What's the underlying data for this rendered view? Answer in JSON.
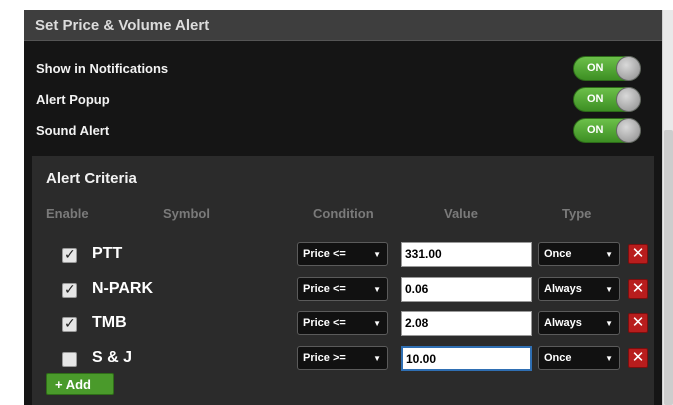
{
  "header": {
    "title": "Set Price & Volume Alert"
  },
  "settings": [
    {
      "label": "Show in Notifications",
      "toggle": "ON"
    },
    {
      "label": "Alert Popup",
      "toggle": "ON"
    },
    {
      "label": "Sound Alert",
      "toggle": "ON"
    }
  ],
  "criteria": {
    "title": "Alert Criteria",
    "columns": {
      "enable": "Enable",
      "symbol": "Symbol",
      "condition": "Condition",
      "value": "Value",
      "type": "Type"
    },
    "rows": [
      {
        "checked": true,
        "symbol": "PTT",
        "condition": "Price <=",
        "value": "331.00",
        "type": "Once"
      },
      {
        "checked": true,
        "symbol": "N-PARK",
        "condition": "Price <=",
        "value": "0.06",
        "type": "Always"
      },
      {
        "checked": true,
        "symbol": "TMB",
        "condition": "Price <=",
        "value": "2.08",
        "type": "Always"
      },
      {
        "checked": false,
        "symbol": "S & J",
        "condition": "Price >=",
        "value": "10.00",
        "type": "Once"
      }
    ],
    "add_label": "+ Add"
  },
  "icons": {
    "delete": "close-icon",
    "dropdown": "caret-down-icon",
    "check": "checkmark-icon"
  },
  "colors": {
    "toggle_on": "#4ea62f",
    "delete": "#b81d1d",
    "add": "#4a9a2b",
    "focus": "#2f6fb3"
  }
}
